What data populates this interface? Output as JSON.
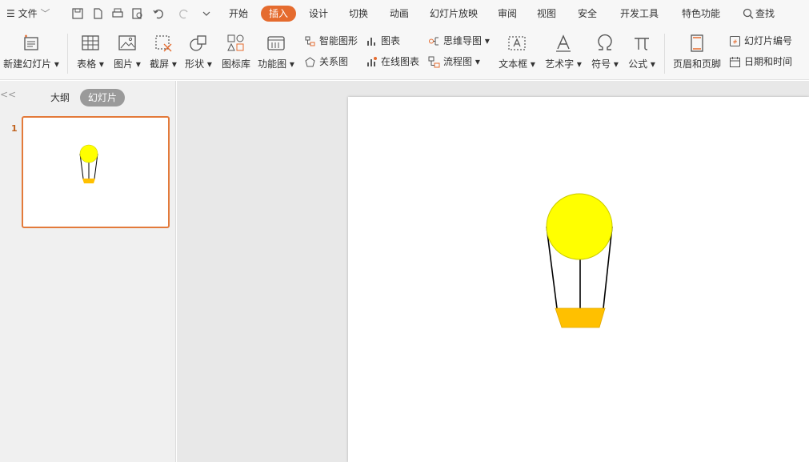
{
  "menubar": {
    "file_label": "文件",
    "tabs": [
      "开始",
      "插入",
      "设计",
      "切换",
      "动画",
      "幻灯片放映",
      "审阅",
      "视图",
      "安全",
      "开发工具",
      "特色功能"
    ],
    "active_tab": "插入",
    "search_label": "查找"
  },
  "ribbon": {
    "new_slide": "新建幻灯片",
    "table": "表格",
    "picture": "图片",
    "screenshot": "截屏",
    "shape": "形状",
    "icon_library": "图标库",
    "function_chart": "功能图",
    "smart_art": "智能图形",
    "chart": "图表",
    "relation_chart": "关系图",
    "online_chart": "在线图表",
    "mind_map": "思维导图",
    "flow_chart": "流程图",
    "text_box": "文本框",
    "word_art": "艺术字",
    "symbol": "符号",
    "formula": "公式",
    "header_footer": "页眉和页脚",
    "slide_number": "幻灯片编号",
    "date_time": "日期和时间"
  },
  "left_panel": {
    "collapse_glyph": "<<",
    "tab_outline": "大纲",
    "tab_slides": "幻灯片",
    "slide_number": "1"
  },
  "colors": {
    "accent": "#e56b2e",
    "balloon": "#ffff00",
    "basket": "#ffc000"
  }
}
